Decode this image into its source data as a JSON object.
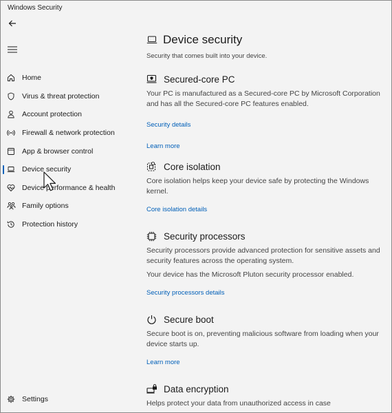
{
  "window": {
    "title": "Windows Security"
  },
  "nav": {
    "items": [
      {
        "label": "Home",
        "icon": "home-icon"
      },
      {
        "label": "Virus & threat protection",
        "icon": "shield-icon"
      },
      {
        "label": "Account protection",
        "icon": "person-icon"
      },
      {
        "label": "Firewall & network protection",
        "icon": "antenna-icon"
      },
      {
        "label": "App & browser control",
        "icon": "app-window-icon"
      },
      {
        "label": "Device security",
        "icon": "laptop-icon",
        "active": true
      },
      {
        "label": "Device performance & health",
        "icon": "heart-pulse-icon"
      },
      {
        "label": "Family options",
        "icon": "family-icon"
      },
      {
        "label": "Protection history",
        "icon": "history-icon"
      }
    ],
    "settings_label": "Settings"
  },
  "main": {
    "title": "Device security",
    "subtitle": "Security that comes built into your device.",
    "sections": {
      "secured_core": {
        "title": "Secured-core PC",
        "desc": "Your PC is manufactured as a Secured-core PC by Microsoft Corporation and has all the Secured-core PC features enabled.",
        "link1": "Security details",
        "link2": "Learn more"
      },
      "core_isolation": {
        "title": "Core isolation",
        "desc": "Core isolation helps keep your device safe by protecting the Windows kernel.",
        "link1": "Core isolation details"
      },
      "security_processors": {
        "title": "Security processors",
        "desc": "Security processors provide advanced protection for sensitive assets and security features across the operating system.",
        "desc2": "Your device has the Microsoft Pluton security processor enabled.",
        "link1": "Security processors details"
      },
      "secure_boot": {
        "title": "Secure boot",
        "desc": "Secure boot is on, preventing malicious software from loading when your device starts up.",
        "link1": "Learn more"
      },
      "data_encryption": {
        "title": "Data encryption",
        "desc": "Helps protect your data from unauthorized access in case"
      }
    }
  },
  "colors": {
    "accent": "#005fb8",
    "background": "#f3f3f3",
    "text": "#1b1b1b"
  }
}
